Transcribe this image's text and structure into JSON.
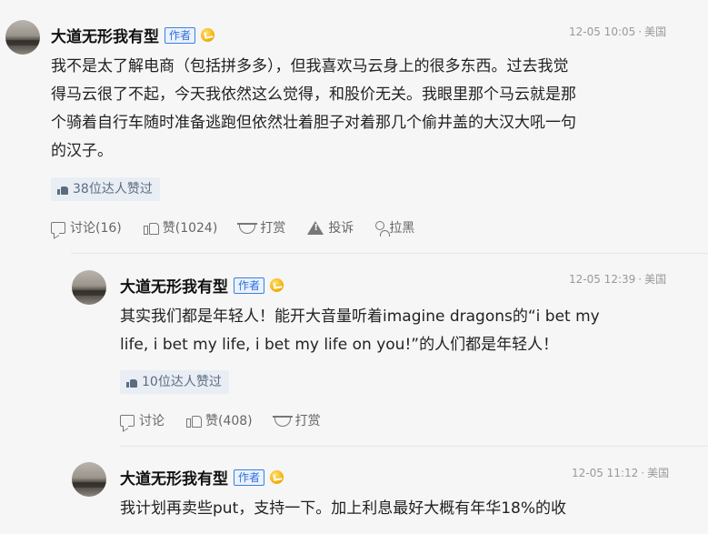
{
  "comments": [
    {
      "username": "大道无形我有型",
      "author_badge": "作者",
      "vip_icon": "gold-vip-badge-icon",
      "time": "12-05 10:05",
      "separator": "·",
      "location": "美国",
      "content_lines": [
        "我不是太了解电商（包括拼多多），但我喜欢马云身上的很多东西。过去我觉",
        "得马云很了不起，今天我依然这么觉得，和股价无关。我眼里那个马云就是那",
        "个骑着自行车随时准备逃跑但依然壮着胆子对着那几个偷井盖的大汉大吼一句",
        "的汉子。"
      ],
      "likers_text": "38位达人赞过",
      "actions": {
        "discuss": "讨论(16)",
        "like": "赞(1024)",
        "tip": "打赏",
        "report": "投诉",
        "block": "拉黑"
      }
    },
    {
      "username": "大道无形我有型",
      "author_badge": "作者",
      "vip_icon": "gold-vip-badge-icon",
      "time": "12-05 12:39",
      "separator": "·",
      "location": "美国",
      "content_lines": [
        "其实我们都是年轻人！能开大音量听着imagine dragons的“i bet my",
        "life, i bet my life, i bet my life on you!”的人们都是年轻人！"
      ],
      "likers_text": "10位达人赞过",
      "actions": {
        "discuss": "讨论",
        "like": "赞(408)",
        "tip": "打赏"
      }
    },
    {
      "username": "大道无形我有型",
      "author_badge": "作者",
      "vip_icon": "gold-vip-badge-icon",
      "time": "12-05 11:12",
      "separator": "·",
      "location": "美国",
      "content_lines": [
        "我计划再卖些put，支持一下。加上利息最好大概有年华18%的收"
      ]
    }
  ]
}
